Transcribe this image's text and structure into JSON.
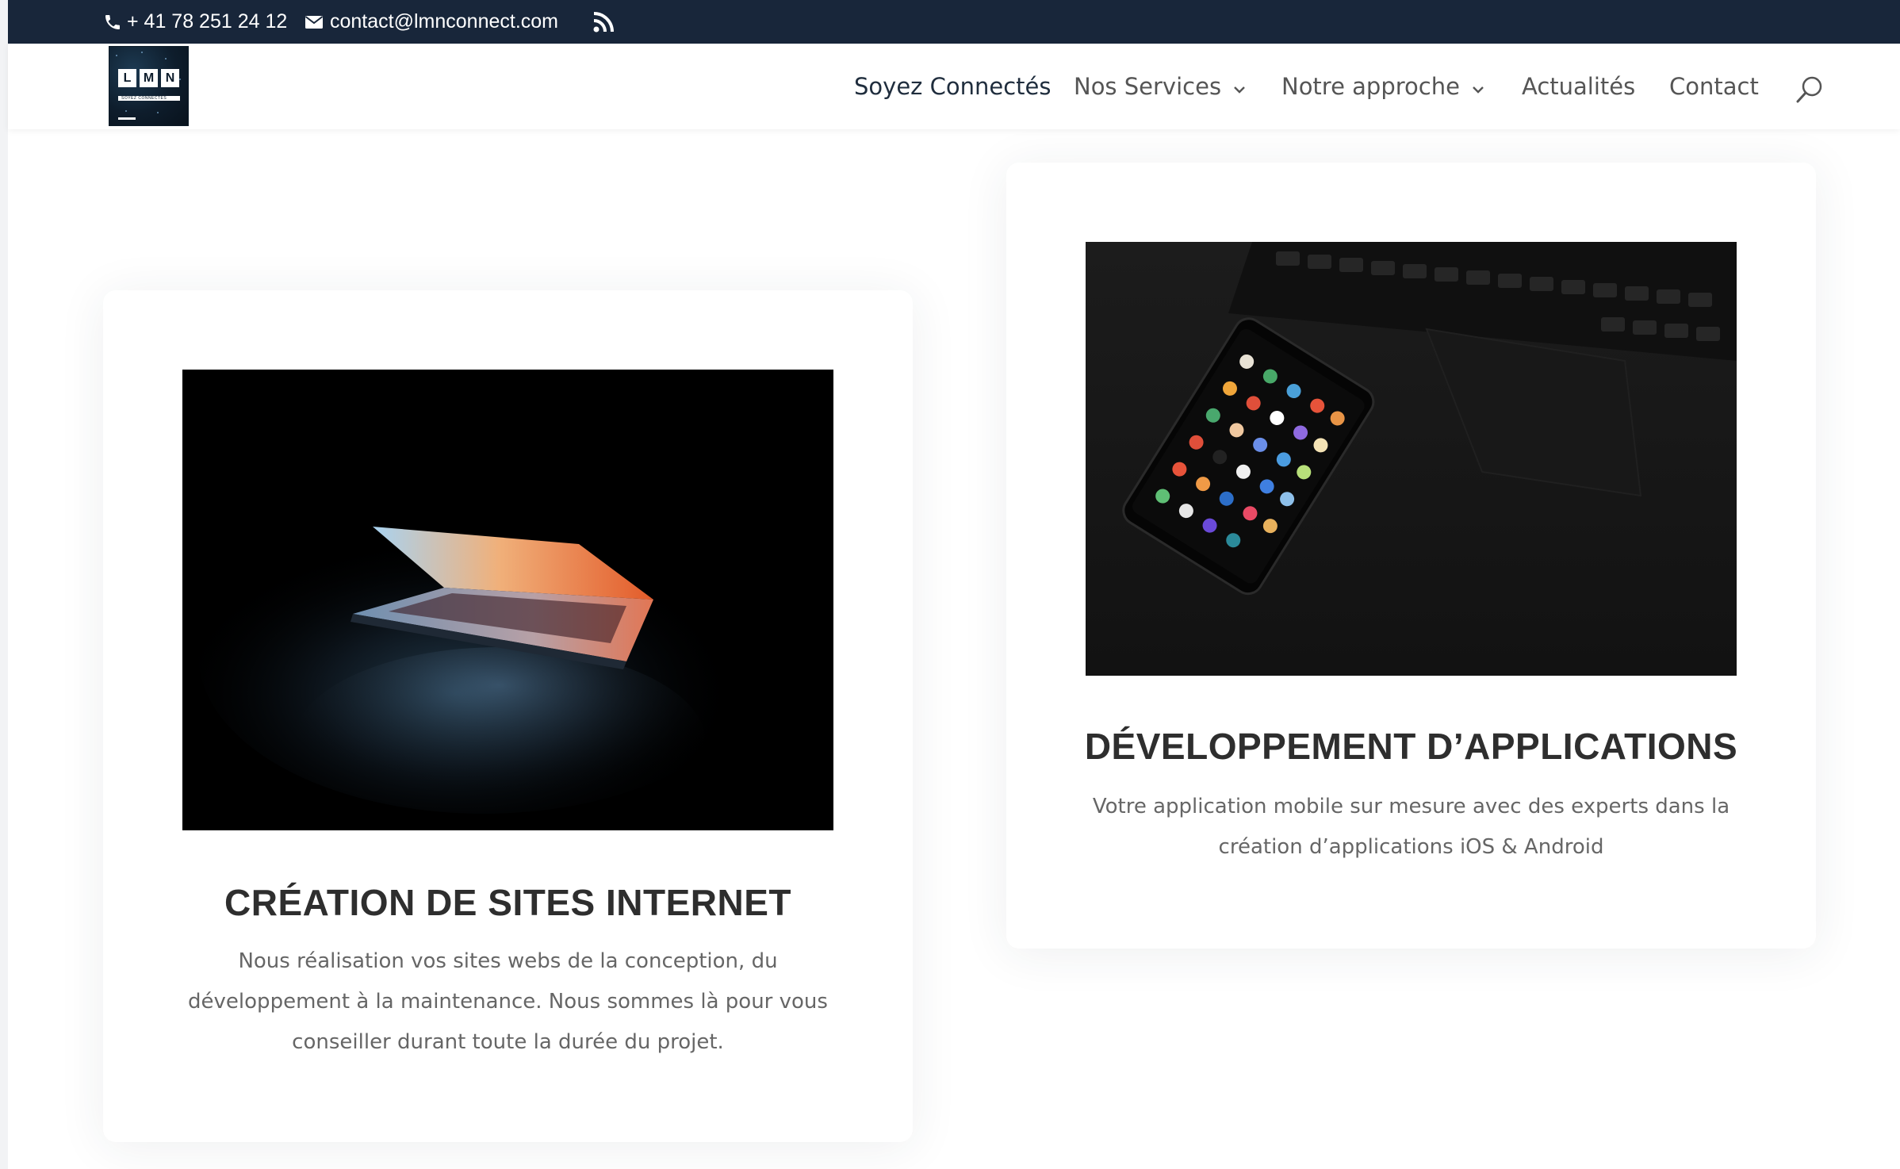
{
  "topbar": {
    "phone": "+ 41 78 251 24 12",
    "email": "contact@lmnconnect.com",
    "icons": {
      "phone": "phone-icon",
      "email": "envelope-icon",
      "rss": "rss-icon"
    },
    "background": "#18263a"
  },
  "header": {
    "logo": {
      "letters": [
        "L",
        "M",
        "N"
      ],
      "tagline": "SOYEZ CONNECTÉS"
    },
    "nav": [
      {
        "label": "Soyez Connectés",
        "active": true,
        "has_dropdown": false
      },
      {
        "label": "Nos Services",
        "active": false,
        "has_dropdown": true
      },
      {
        "label": "Notre approche",
        "active": false,
        "has_dropdown": true
      },
      {
        "label": "Actualités",
        "active": false,
        "has_dropdown": false
      },
      {
        "label": "Contact",
        "active": false,
        "has_dropdown": false
      }
    ],
    "search_icon": "search-icon"
  },
  "cards": [
    {
      "title": "CRÉATION DE SITES INTERNET",
      "text": "Nous réalisation vos sites webs de la conception, du développement à  la maintenance. Nous sommes là pour vous conseiller durant toute la durée du projet.",
      "image": "laptop-in-dark-photo"
    },
    {
      "title": "DÉVELOPPEMENT D’APPLICATIONS",
      "text": "Votre application mobile sur mesure avec des experts dans la création d’applications iOS & Android",
      "image": "smartphone-on-keyboard-photo"
    }
  ],
  "colors": {
    "nav_text": "#555555",
    "nav_active": "#1f2d3d",
    "heading": "#2e2e2e",
    "body_text": "#666666"
  }
}
